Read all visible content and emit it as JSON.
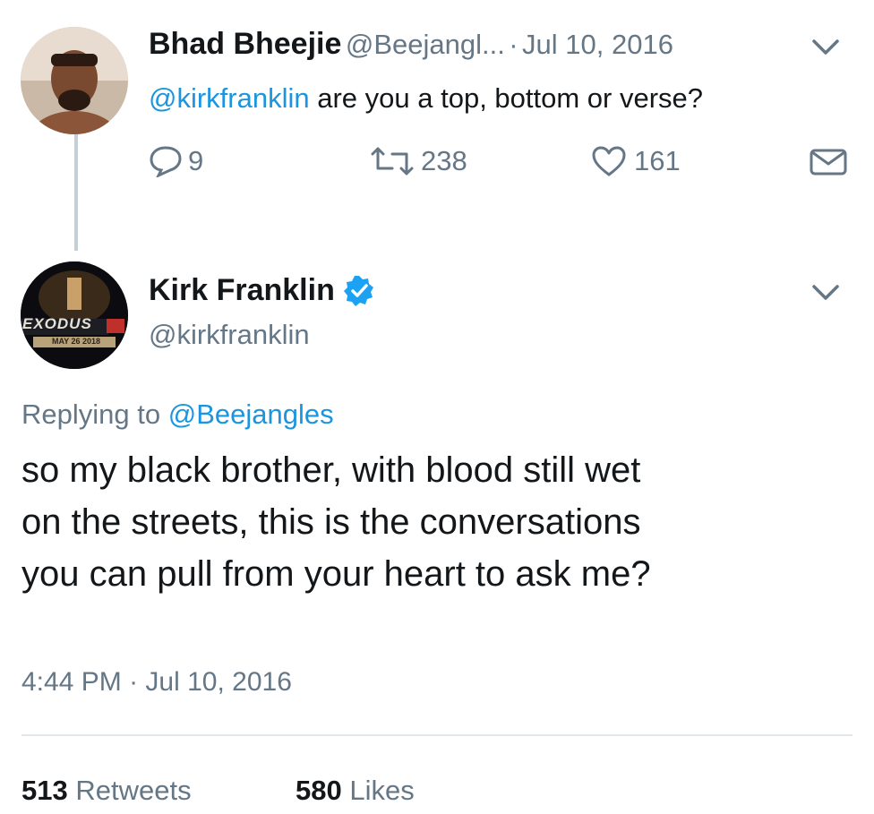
{
  "colors": {
    "link": "#1b95e0",
    "secondary_text": "#657786",
    "primary_text": "#14171a",
    "verified_badge": "#1da1f2",
    "divider": "#e1e8ed"
  },
  "parent_tweet": {
    "author_name": "Bhad Bheejie",
    "author_handle": "@Beejangl...",
    "separator": "·",
    "date": "Jul 10, 2016",
    "text_mention": "@kirkfranklin",
    "text_body": " are you a top, bottom or verse?",
    "replies_count": "9",
    "retweets_count": "238",
    "likes_count": "161",
    "icons": [
      "reply-icon",
      "retweet-icon",
      "like-icon",
      "direct-message-icon",
      "chevron-down-icon"
    ]
  },
  "reply_tweet": {
    "author_name": "Kirk Franklin",
    "author_handle": "@kirkfranklin",
    "verified": true,
    "avatar_text": {
      "line1": "EXODUS",
      "line2": "MAY 26 2018"
    },
    "replying_to_label": "Replying to ",
    "replying_to_handle": "@Beejangles",
    "text_line1": "so my black brother, with blood still wet",
    "text_line2": "on the streets, this is the conversations",
    "text_line3": "you can pull from your heart to ask me?",
    "time": "4:44 PM",
    "separator": "·",
    "date": "Jul 10, 2016",
    "retweets_count": "513",
    "retweets_label": "Retweets",
    "likes_count": "580",
    "likes_label": "Likes"
  }
}
